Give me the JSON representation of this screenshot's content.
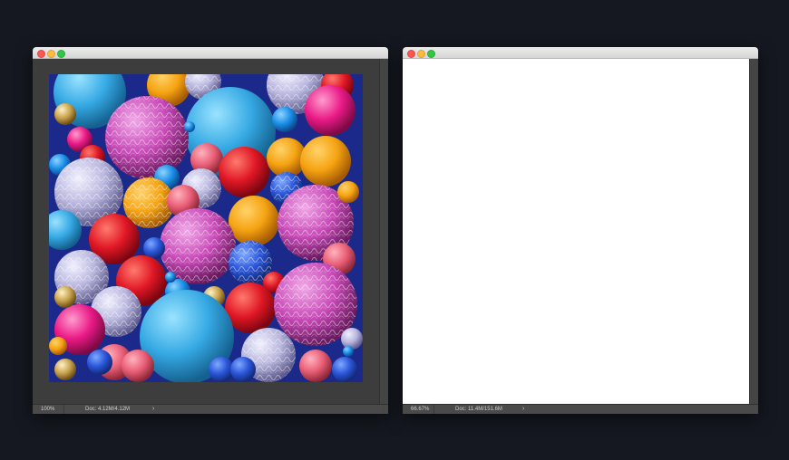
{
  "windows": [
    {
      "status": {
        "zoom": "100%",
        "doc": "Doc: 4.12M/4.12M",
        "chevron": "›"
      }
    },
    {
      "status": {
        "zoom": "66.67%",
        "doc": "Doc: 11.4M/151.6M",
        "chevron": "›"
      }
    }
  ],
  "colors": {
    "background": "#151820",
    "image_backdrop": "#1b2a8a",
    "close": "#fc5753",
    "minimize": "#fdbc40",
    "zoom": "#33c748"
  }
}
